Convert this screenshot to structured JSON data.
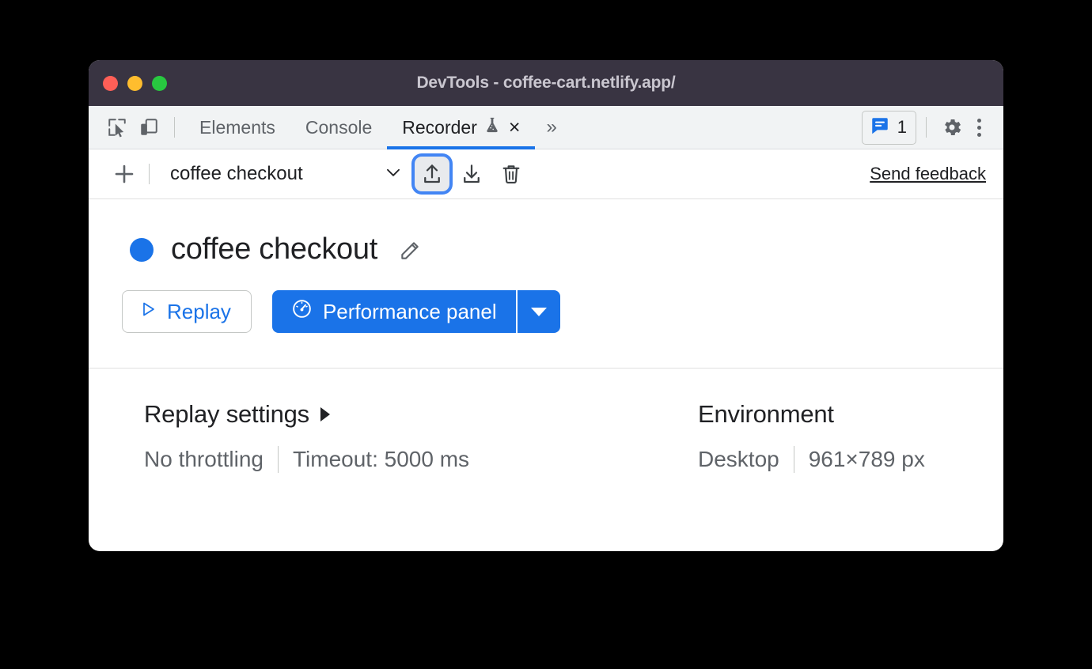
{
  "window": {
    "title": "DevTools - coffee-cart.netlify.app/",
    "traffic_lights": [
      "close",
      "minimize",
      "maximize"
    ]
  },
  "tabbar": {
    "inspect_icon": "inspect-cursor-icon",
    "device_icon": "device-toolbar-icon",
    "tabs": [
      {
        "label": "Elements",
        "active": false
      },
      {
        "label": "Console",
        "active": false
      },
      {
        "label": "Recorder",
        "active": true,
        "experiment_icon": "flask-icon",
        "close": "×"
      }
    ],
    "more_tabs": "»",
    "issues": {
      "icon": "issues-message-icon",
      "count": "1"
    },
    "settings_icon": "gear-icon",
    "menu_icon": "kebab-menu-icon"
  },
  "recorder_toolbar": {
    "add_label": "+",
    "recording_name": "coffee checkout",
    "chevron_icon": "chevron-down-icon",
    "import_icon": "export-upload-icon",
    "export_icon": "import-download-icon",
    "delete_icon": "trash-icon",
    "feedback_label": "Send feedback"
  },
  "recording": {
    "status_dot_color": "#1a73e8",
    "title": "coffee checkout",
    "edit_icon": "pencil-icon",
    "replay_label": "Replay",
    "replay_icon": "play-triangle-icon",
    "performance_label": "Performance panel",
    "performance_icon": "gauge-icon",
    "performance_dropdown_icon": "caret-down-icon"
  },
  "replay_settings": {
    "heading": "Replay settings",
    "expand_icon": "caret-right-icon",
    "throttling": "No throttling",
    "timeout": "Timeout: 5000 ms"
  },
  "environment": {
    "heading": "Environment",
    "device": "Desktop",
    "viewport": "961×789 px"
  },
  "colors": {
    "accent": "#1a73e8",
    "titlebar": "#393442",
    "tabbar": "#f1f3f4",
    "focus_ring": "#4285f4"
  }
}
